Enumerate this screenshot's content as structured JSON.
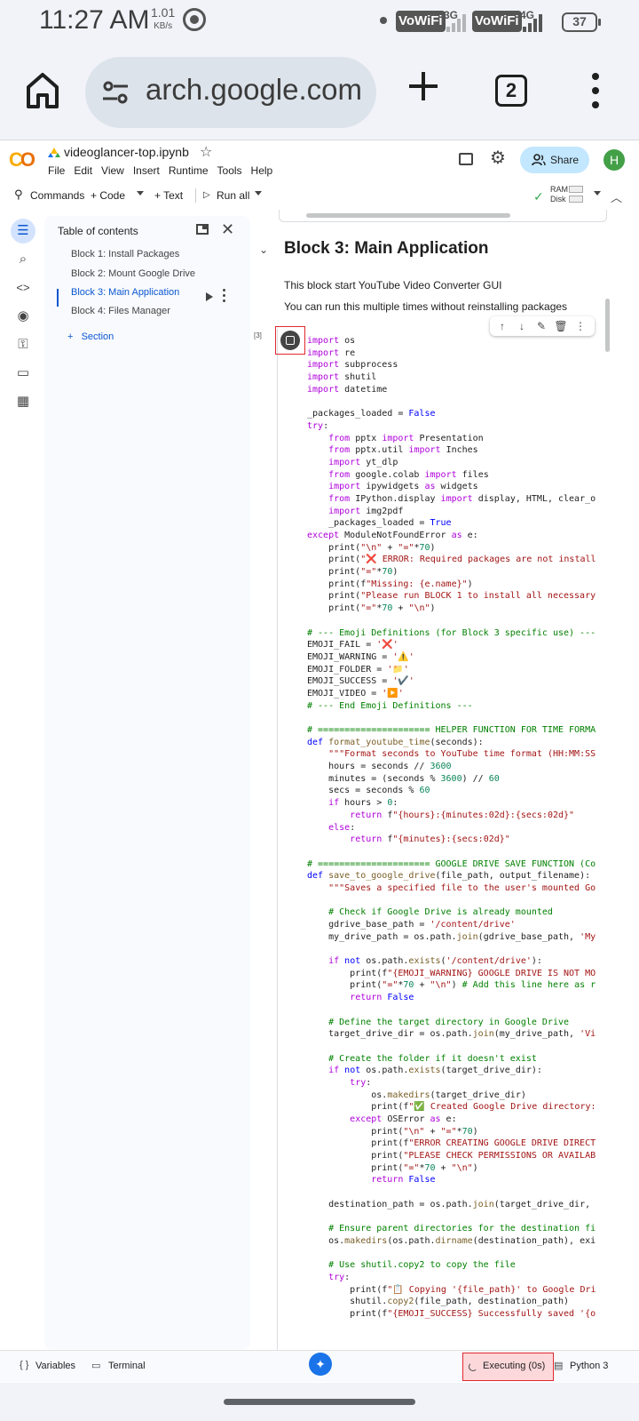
{
  "status_bar": {
    "time": "11:27 AM",
    "speed_value": "1.01",
    "speed_unit": "KB/s",
    "vowifi_1": "VoWiFi",
    "net_1": "3G",
    "vowifi_2": "VoWiFi",
    "net_2": "4G",
    "battery": "37"
  },
  "browser": {
    "url": "arch.google.com",
    "tab_count": "2"
  },
  "colab": {
    "notebook_title": "videoglancer-top.ipynb",
    "menu": [
      "File",
      "Edit",
      "View",
      "Insert",
      "Runtime",
      "Tools",
      "Help"
    ],
    "share_label": "Share",
    "avatar_initial": "H",
    "toolbar": {
      "commands": "Commands",
      "code": "+ Code",
      "text": "+ Text",
      "run_all": "Run all",
      "ram": "RAM",
      "disk": "Disk"
    }
  },
  "toc": {
    "title": "Table of contents",
    "items": [
      "Block 1: Install Packages",
      "Block 2: Mount Google Drive",
      "Block 3: Main Application",
      "Block 4: Files Manager"
    ],
    "active_index": 2,
    "add_section": "Section"
  },
  "notebook": {
    "heading": "Block 3: Main Application",
    "para_1": "This block start YouTube Video Converter GUI",
    "para_2": "You can run this multiple times without reinstalling packages",
    "exec_count": "[3]"
  },
  "code_lines": [
    "import os",
    "import re",
    "import subprocess",
    "import shutil",
    "import datetime",
    "",
    "_packages_loaded = False",
    "try:",
    "    from pptx import Presentation",
    "    from pptx.util import Inches",
    "    import yt_dlp",
    "    from google.colab import files",
    "    import ipywidgets as widgets",
    "    from IPython.display import display, HTML, clear_o",
    "    import img2pdf",
    "    _packages_loaded = True",
    "except ModuleNotFoundError as e:",
    "    print(\"\\n\" + \"=\"*70)",
    "    print(\"❌ ERROR: Required packages are not install",
    "    print(\"=\"*70)",
    "    print(f\"Missing: {e.name}\")",
    "    print(\"Please run BLOCK 1 to install all necessary",
    "    print(\"=\"*70 + \"\\n\")",
    "",
    "# --- Emoji Definitions (for Block 3 specific use) ---",
    "EMOJI_FAIL = '❌'",
    "EMOJI_WARNING = '⚠️'",
    "EMOJI_FOLDER = '📁'",
    "EMOJI_SUCCESS = '✔️'",
    "EMOJI_VIDEO = '▶️'",
    "# --- End Emoji Definitions ---",
    "",
    "# ===================== HELPER FUNCTION FOR TIME FORMA",
    "def format_youtube_time(seconds):",
    "    \"\"\"Format seconds to YouTube time format (HH:MM:SS",
    "    hours = seconds // 3600",
    "    minutes = (seconds % 3600) // 60",
    "    secs = seconds % 60",
    "    if hours > 0:",
    "        return f\"{hours}:{minutes:02d}:{secs:02d}\"",
    "    else:",
    "        return f\"{minutes}:{secs:02d}\"",
    "",
    "# ===================== GOOGLE DRIVE SAVE FUNCTION (Co",
    "def save_to_google_drive(file_path, output_filename):",
    "    \"\"\"Saves a specified file to the user's mounted Go",
    "",
    "    # Check if Google Drive is already mounted",
    "    gdrive_base_path = '/content/drive'",
    "    my_drive_path = os.path.join(gdrive_base_path, 'My",
    "",
    "    if not os.path.exists('/content/drive'):",
    "        print(f\"{EMOJI_WARNING} GOOGLE DRIVE IS NOT MO",
    "        print(\"=\"*70 + \"\\n\") # Add this line here as r",
    "        return False",
    "",
    "    # Define the target directory in Google Drive",
    "    target_drive_dir = os.path.join(my_drive_path, 'Vi",
    "",
    "    # Create the folder if it doesn't exist",
    "    if not os.path.exists(target_drive_dir):",
    "        try:",
    "            os.makedirs(target_drive_dir)",
    "            print(f\"✅ Created Google Drive directory:",
    "        except OSError as e:",
    "            print(\"\\n\" + \"=\"*70)",
    "            print(f\"ERROR CREATING GOOGLE DRIVE DIRECT",
    "            print(\"PLEASE CHECK PERMISSIONS OR AVAILAB",
    "            print(\"=\"*70 + \"\\n\")",
    "            return False",
    "",
    "    destination_path = os.path.join(target_drive_dir,",
    "",
    "    # Ensure parent directories for the destination fi",
    "    os.makedirs(os.path.dirname(destination_path), exi",
    "",
    "    # Use shutil.copy2 to copy the file",
    "    try:",
    "        print(f\"📋 Copying '{file_path}' to Google Dri",
    "        shutil.copy2(file_path, destination_path)",
    "        print(f\"{EMOJI_SUCCESS} Successfully saved '{o"
  ],
  "footer": {
    "variables": "Variables",
    "terminal": "Terminal",
    "executing": "Executing (0s)",
    "kernel": "Python 3"
  }
}
